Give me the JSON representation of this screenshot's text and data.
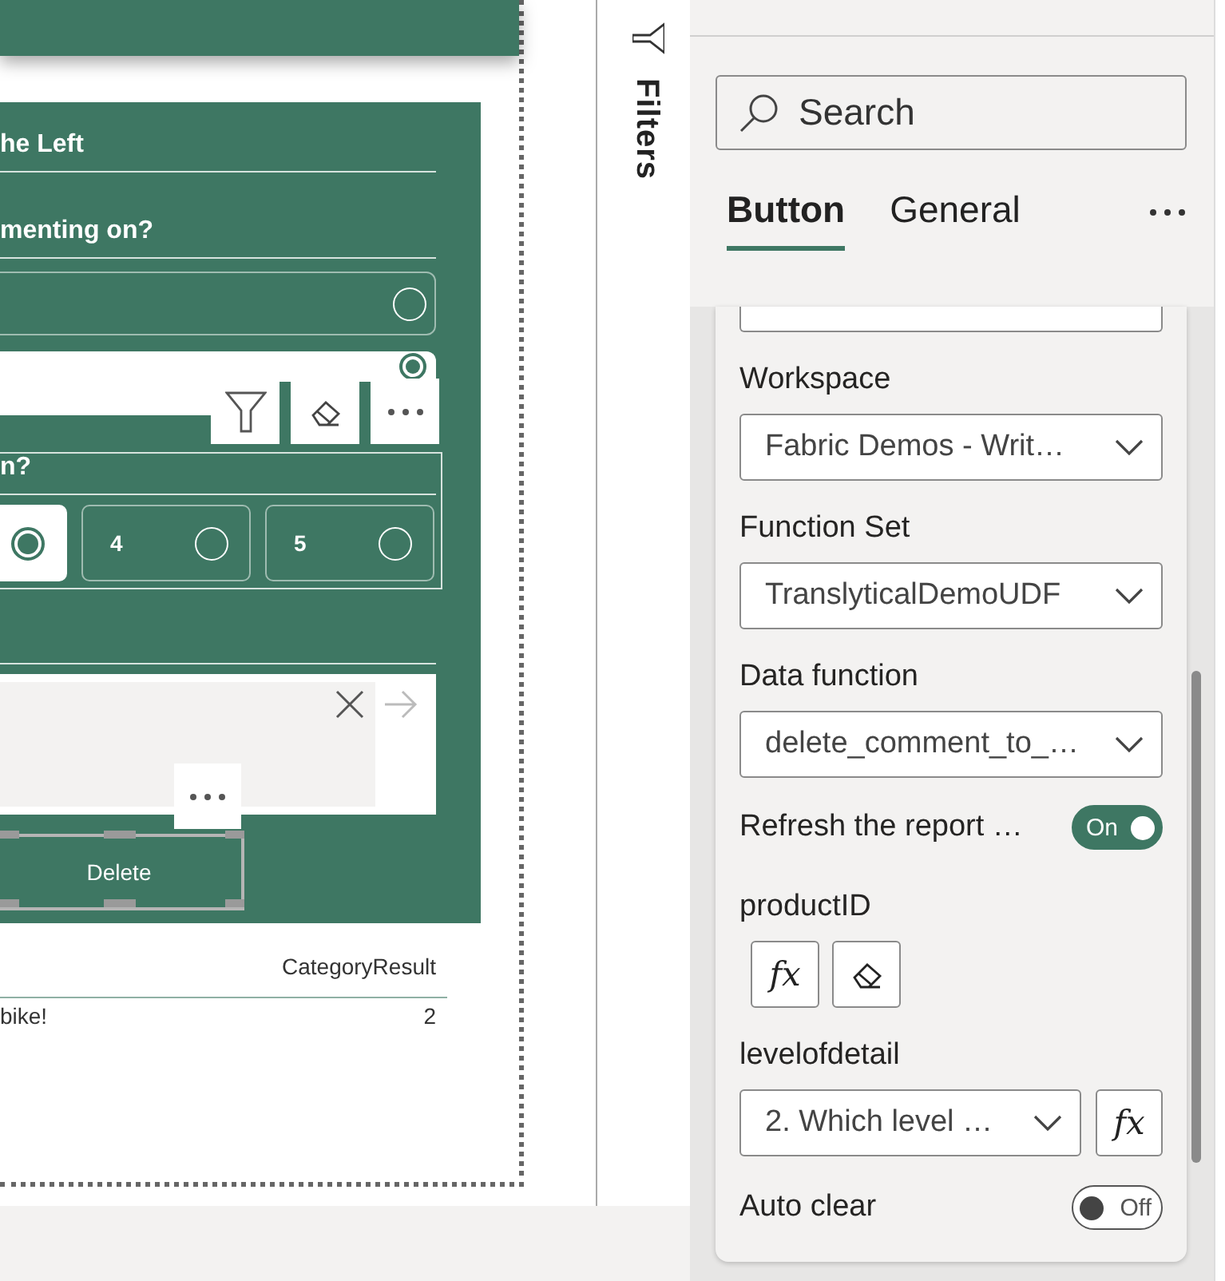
{
  "report_canvas": {
    "form": {
      "title": "he Left",
      "questions": [
        {
          "kind": "choice",
          "label": "menting on?",
          "options": [
            {
              "selected": false
            },
            {
              "selected": true
            }
          ]
        },
        {
          "kind": "rating",
          "label": "n?",
          "options": [
            {
              "selected": true
            },
            {
              "label": "4",
              "selected": false
            },
            {
              "label": "5",
              "selected": false
            }
          ]
        }
      ],
      "delete_button": "Delete"
    },
    "table": {
      "header": "CategoryResult",
      "rows": [
        [
          "bike!",
          "2"
        ]
      ]
    }
  },
  "filters_pane": {
    "label": "Filters"
  },
  "format_pane": {
    "search": {
      "placeholder": "Search"
    },
    "tabs": [
      {
        "label": "Button",
        "selected": true
      },
      {
        "label": "General",
        "selected": false
      }
    ],
    "settings": [
      {
        "kind": "dropdown",
        "label": "Workspace",
        "value": "Fabric Demos - Writ…"
      },
      {
        "kind": "dropdown",
        "label": "Function Set",
        "value": "TranslyticalDemoUDF"
      },
      {
        "kind": "dropdown",
        "label": "Data function",
        "value": "delete_comment_to_…"
      },
      {
        "kind": "toggle",
        "label": "Refresh the report …",
        "on": true,
        "state_label": "On"
      },
      {
        "kind": "buttons",
        "label": "productID",
        "fx_label": "fx"
      },
      {
        "kind": "dropdown_fx",
        "label": "levelofdetail",
        "value": "2. Which level …",
        "fx_label": "fx"
      },
      {
        "kind": "toggle",
        "label": "Auto clear",
        "on": false,
        "state_label": "Off"
      }
    ]
  }
}
